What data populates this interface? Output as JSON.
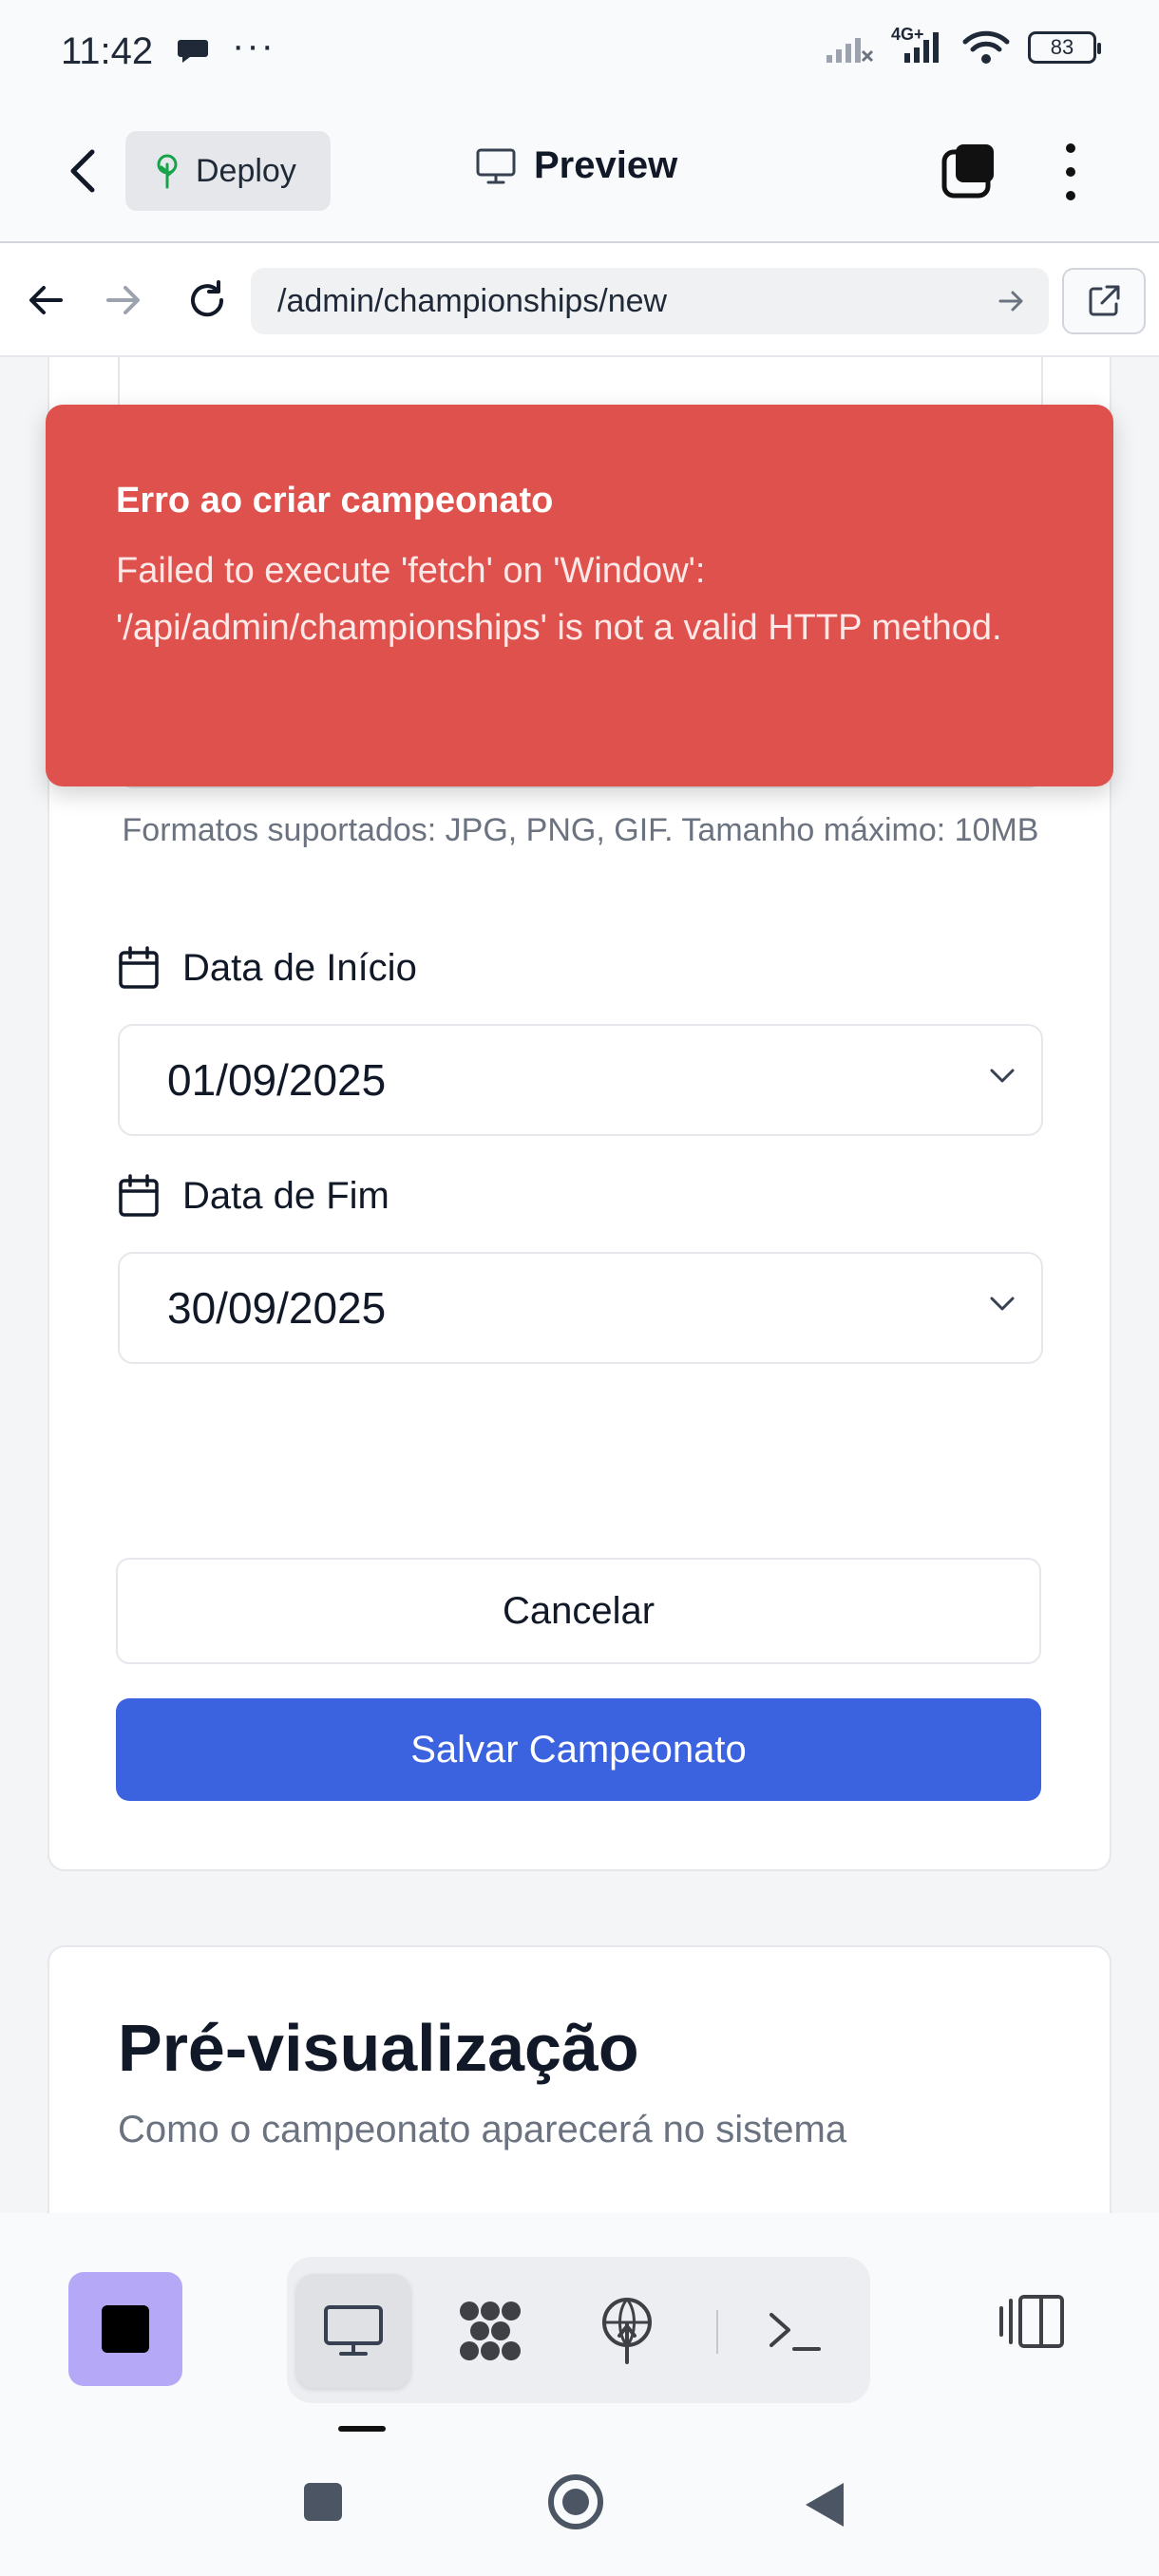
{
  "status_bar": {
    "time": "11:42",
    "dots": "···",
    "network": "4G+",
    "battery": "83"
  },
  "app_header": {
    "deploy_label": "Deploy",
    "title": "Preview"
  },
  "browser": {
    "url": "/admin/championships/new"
  },
  "form": {
    "upload_note": "Formatos suportados: JPG, PNG, GIF. Tamanho máximo: 10MB",
    "start_date": {
      "label": "Data de Início",
      "value": "01/09/2025"
    },
    "end_date": {
      "label": "Data de Fim",
      "value": "30/09/2025"
    },
    "cancel_label": "Cancelar",
    "save_label": "Salvar Campeonato"
  },
  "preview_card": {
    "title": "Pré-visualização",
    "subtitle": "Como o campeonato aparecerá no sistema"
  },
  "toast": {
    "title": "Erro ao criar campeonato",
    "message": "Failed to execute 'fetch' on 'Window': '/api/admin/championships' is not a valid HTTP method."
  },
  "colors": {
    "accent": "#3b63e0",
    "error": "#de514d",
    "stop": "#b5a8f7"
  },
  "icons": [
    "back-icon",
    "deploy-tree-icon",
    "monitor-icon",
    "tabs-icon",
    "more-vertical-icon",
    "arrow-left-icon",
    "arrow-right-icon",
    "reload-icon",
    "external-link-icon",
    "calendar-icon",
    "chevron-down-icon",
    "stop-icon",
    "network-icon",
    "globe-icon",
    "terminal-icon",
    "panel-icon"
  ]
}
